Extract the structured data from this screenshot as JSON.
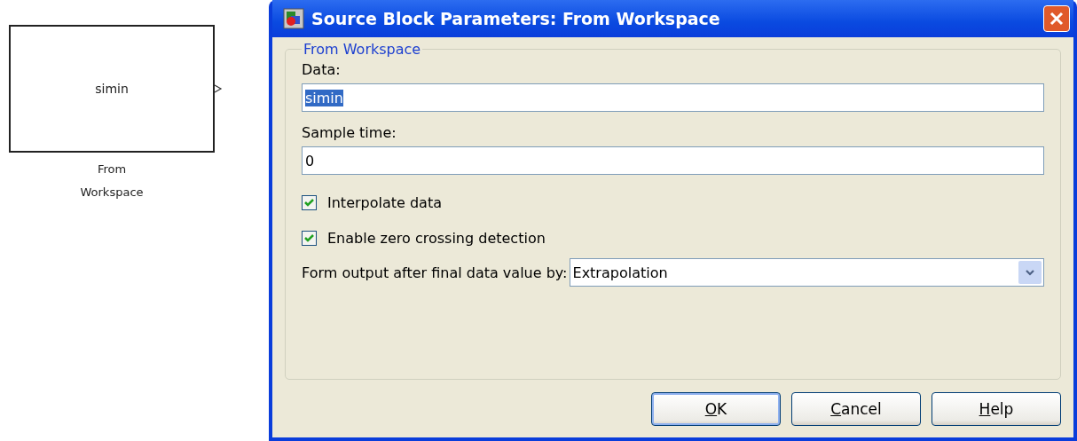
{
  "block": {
    "text": "simin",
    "caption_lines": [
      "From",
      "Workspace"
    ]
  },
  "window": {
    "title": "Source Block Parameters: From Workspace"
  },
  "group": {
    "title": "From Workspace",
    "data": {
      "label": "Data:",
      "value": "simin",
      "selected": true
    },
    "sample_time": {
      "label": "Sample time:",
      "value": "0"
    },
    "checkboxes": [
      {
        "label": "Interpolate data",
        "checked": true
      },
      {
        "label": "Enable zero crossing detection",
        "checked": true
      }
    ],
    "output": {
      "label": "Form output after final data value by:",
      "value": "Extrapolation"
    }
  },
  "buttons": [
    {
      "label": "OK",
      "underline_first": true,
      "default": true
    },
    {
      "label": "Cancel",
      "underline_first": true,
      "default": false
    },
    {
      "label": "Help",
      "underline_first": true,
      "default": false
    }
  ]
}
